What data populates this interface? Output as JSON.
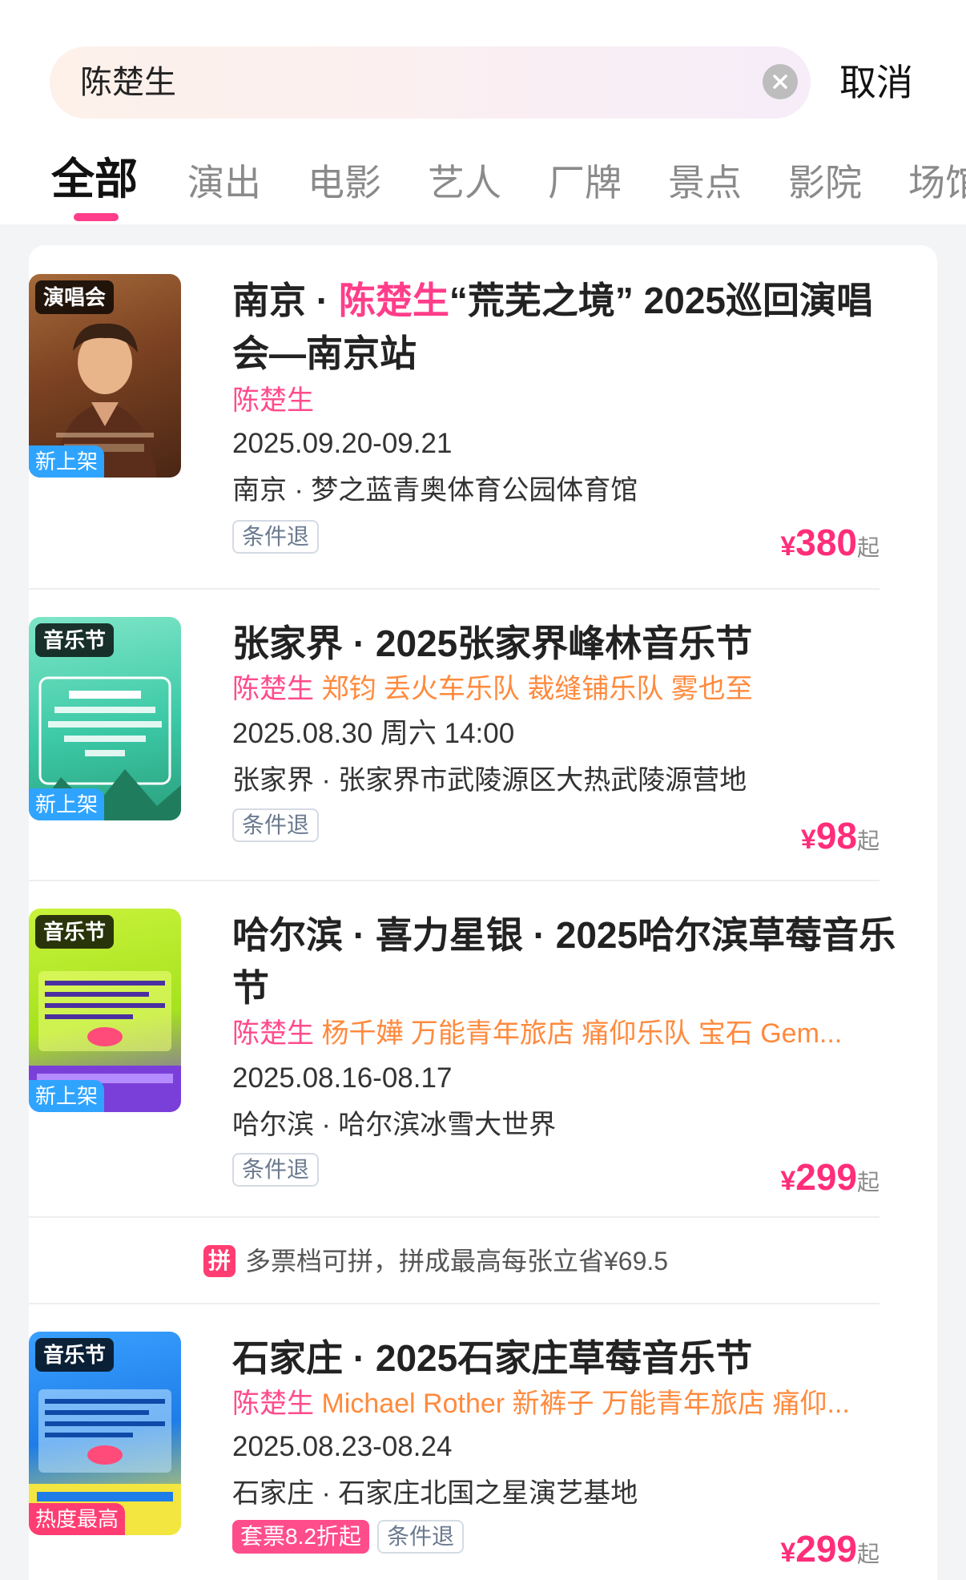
{
  "search": {
    "query": "陈楚生",
    "cancel_label": "取消"
  },
  "tabs": [
    "全部",
    "演出",
    "电影",
    "艺人",
    "厂牌",
    "景点",
    "影院",
    "场馆"
  ],
  "results": [
    {
      "category_tag": "演唱会",
      "badge": "新上架",
      "poster_icon": "concert-poster",
      "title_prefix": "南京 · ",
      "title_highlight": "陈楚生",
      "title_suffix": "“荒芜之境” 2025巡回演唱会—南京站",
      "artist_highlight": "陈楚生",
      "artist_rest": "",
      "date": "2025.09.20-09.21",
      "venue": "南京 · 梦之蓝青奥体育公园体育馆",
      "discount": "",
      "refund": "条件退",
      "price_symbol": "¥",
      "price": "380",
      "price_suffix": "起"
    },
    {
      "category_tag": "音乐节",
      "badge": "新上架",
      "poster_icon": "festival-poster",
      "title_prefix": "张家界 · 2025张家界峰林音乐节",
      "title_highlight": "",
      "title_suffix": "",
      "artist_highlight": "陈楚生",
      "artist_rest": " 郑钧 丢火车乐队 裁缝铺乐队 雾也至",
      "date": "2025.08.30 周六 14:00",
      "venue": "张家界 · 张家界市武陵源区大热武陵源营地",
      "discount": "",
      "refund": "条件退",
      "price_symbol": "¥",
      "price": "98",
      "price_suffix": "起"
    },
    {
      "category_tag": "音乐节",
      "badge": "新上架",
      "poster_icon": "festival-poster",
      "title_prefix": "哈尔滨 · 喜力星银 · 2025哈尔滨草莓音乐节",
      "title_highlight": "",
      "title_suffix": "",
      "artist_highlight": "陈楚生",
      "artist_rest": " 杨千嬅 万能青年旅店 痛仰乐队 宝石 Gem...",
      "date": "2025.08.16-08.17",
      "venue": "哈尔滨 · 哈尔滨冰雪大世界",
      "discount": "",
      "refund": "条件退",
      "price_symbol": "¥",
      "price": "299",
      "price_suffix": "起",
      "group_icon": "拼",
      "group_note": "多票档可拼，拼成最高每张立省¥69.5"
    },
    {
      "category_tag": "音乐节",
      "badge": "热度最高",
      "poster_icon": "festival-poster",
      "title_prefix": "石家庄 · 2025石家庄草莓音乐节",
      "title_highlight": "",
      "title_suffix": "",
      "artist_highlight": "陈楚生",
      "artist_rest": " Michael Rother 新裤子 万能青年旅店 痛仰...",
      "date": "2025.08.23-08.24",
      "venue": "石家庄 · 石家庄北国之星演艺基地",
      "discount": "套票8.2折起",
      "refund": "条件退",
      "price_symbol": "¥",
      "price": "299",
      "price_suffix": "起"
    }
  ],
  "colors": {
    "accent": "#ff3d8a",
    "artist_orange": "#ff8a3d",
    "badge_blue": "#2fa4ff",
    "badge_hot": "#ff3d72"
  }
}
